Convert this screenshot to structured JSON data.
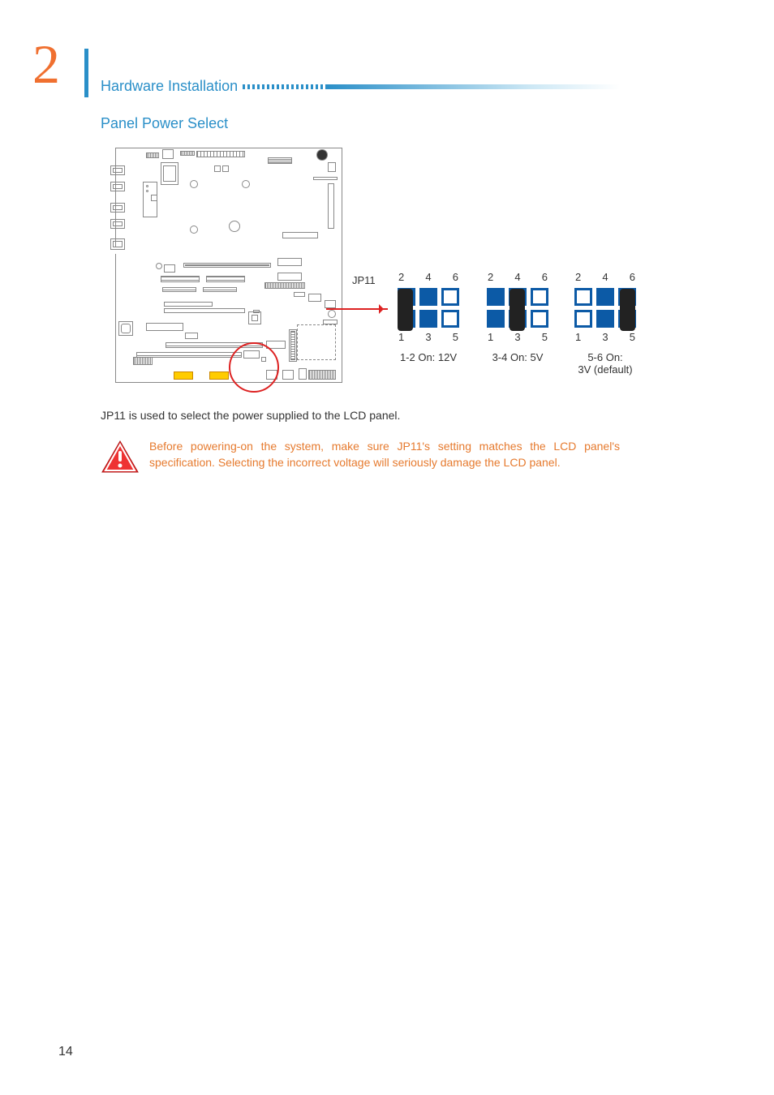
{
  "chapter": {
    "number": "2",
    "title": "Hardware Installation"
  },
  "section": {
    "title": "Panel Power Select"
  },
  "jumper": {
    "name": "JP11"
  },
  "chart_data": {
    "type": "table",
    "title": "JP11 Panel Power Select jumper settings",
    "pin_layout": {
      "rows": 2,
      "cols": 3,
      "top_pins": [
        2,
        4,
        6
      ],
      "bottom_pins": [
        1,
        3,
        5
      ]
    },
    "settings": [
      {
        "caption": "1-2 On: 12V",
        "closed_pair": [
          1,
          2
        ],
        "voltage": "12V",
        "default": false
      },
      {
        "caption": "3-4 On: 5V",
        "closed_pair": [
          3,
          4
        ],
        "voltage": "5V",
        "default": false
      },
      {
        "caption": "5-6 On:\n3V (default)",
        "closed_pair": [
          5,
          6
        ],
        "voltage": "3V",
        "default": true
      }
    ],
    "pin_numbers": {
      "top": [
        "2",
        "4",
        "6"
      ],
      "bottom": [
        "1",
        "3",
        "5"
      ]
    }
  },
  "body": "JP11 is used to select the power supplied to the LCD panel.",
  "warning": "Before powering-on the system, make sure JP11's setting matches the LCD panel's specification. Selecting the incorrect voltage will seriously damage the LCD panel.",
  "page_number": "14"
}
